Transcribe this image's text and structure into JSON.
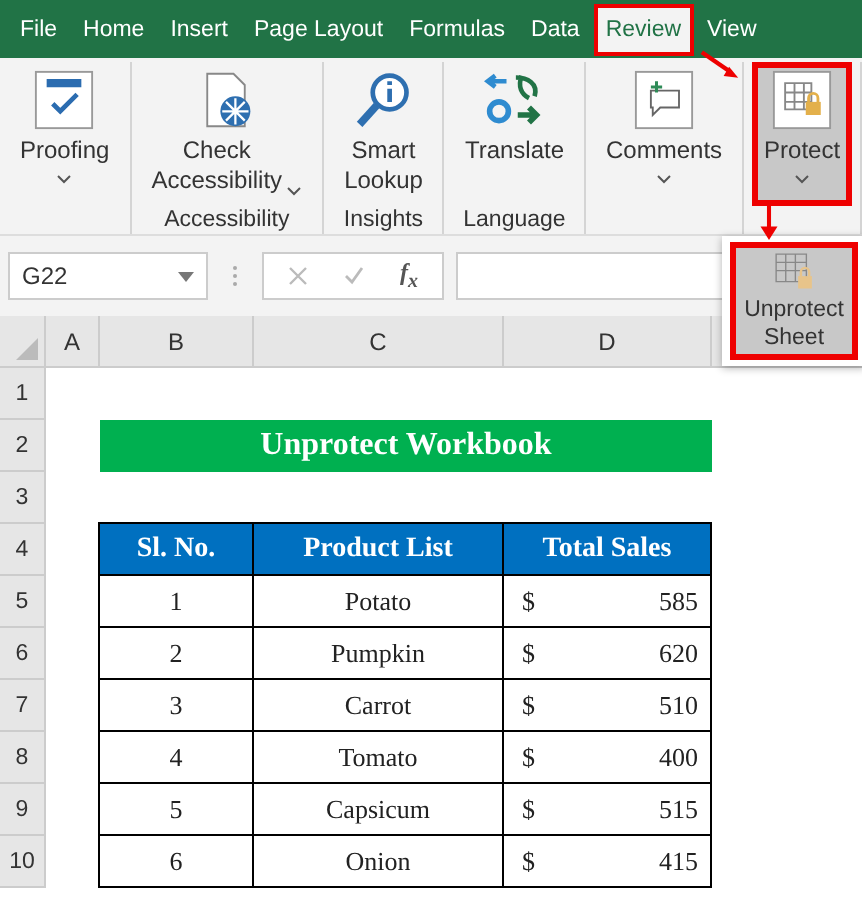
{
  "tabs": [
    {
      "label": "File",
      "selected": false
    },
    {
      "label": "Home",
      "selected": false
    },
    {
      "label": "Insert",
      "selected": false
    },
    {
      "label": "Page Layout",
      "selected": false
    },
    {
      "label": "Formulas",
      "selected": false
    },
    {
      "label": "Data",
      "selected": false
    },
    {
      "label": "Review",
      "selected": true
    },
    {
      "label": "View",
      "selected": false
    }
  ],
  "ribbon": {
    "groups": [
      {
        "buttons": [
          {
            "label": "Proofing",
            "kind": "proofing",
            "dropdown": true,
            "highlighted": false
          }
        ]
      },
      {
        "label": "Accessibility",
        "buttons": [
          {
            "label": "Check Accessibility",
            "kind": "accessibility",
            "dropdown": true,
            "highlighted": false
          }
        ]
      },
      {
        "label": "Insights",
        "buttons": [
          {
            "label": "Smart Lookup",
            "kind": "lookup",
            "dropdown": false,
            "highlighted": false
          }
        ]
      },
      {
        "label": "Language",
        "buttons": [
          {
            "label": "Translate",
            "kind": "translate",
            "dropdown": false,
            "highlighted": false
          }
        ]
      },
      {
        "buttons": [
          {
            "label": "Comments",
            "kind": "comments",
            "dropdown": true,
            "highlighted": false
          }
        ]
      },
      {
        "buttons": [
          {
            "label": "Protect",
            "kind": "protect",
            "dropdown": true,
            "highlighted": true
          }
        ]
      }
    ]
  },
  "protect_menu": {
    "items": [
      {
        "label": "Unprotect Sheet",
        "highlighted": true
      }
    ]
  },
  "name_box": "G22",
  "formula_bar": {
    "function_label": "f$_{x}$"
  },
  "columns": [
    "A",
    "B",
    "C",
    "D"
  ],
  "rows": [
    "1",
    "2",
    "3",
    "4",
    "5",
    "6",
    "7",
    "8",
    "9",
    "10"
  ],
  "sheet": {
    "title": "Unprotect Workbook",
    "table": {
      "columns": [
        "Sl. No.",
        "Product List",
        "Total Sales"
      ],
      "rows": [
        {
          "sl": "1",
          "product": "Potato",
          "currency": "$",
          "sales": "585"
        },
        {
          "sl": "2",
          "product": "Pumpkin",
          "currency": "$",
          "sales": "620"
        },
        {
          "sl": "3",
          "product": "Carrot",
          "currency": "$",
          "sales": "510"
        },
        {
          "sl": "4",
          "product": "Tomato",
          "currency": "$",
          "sales": "400"
        },
        {
          "sl": "5",
          "product": "Capsicum",
          "currency": "$",
          "sales": "515"
        },
        {
          "sl": "6",
          "product": "Onion",
          "currency": "$",
          "sales": "415"
        }
      ]
    }
  }
}
